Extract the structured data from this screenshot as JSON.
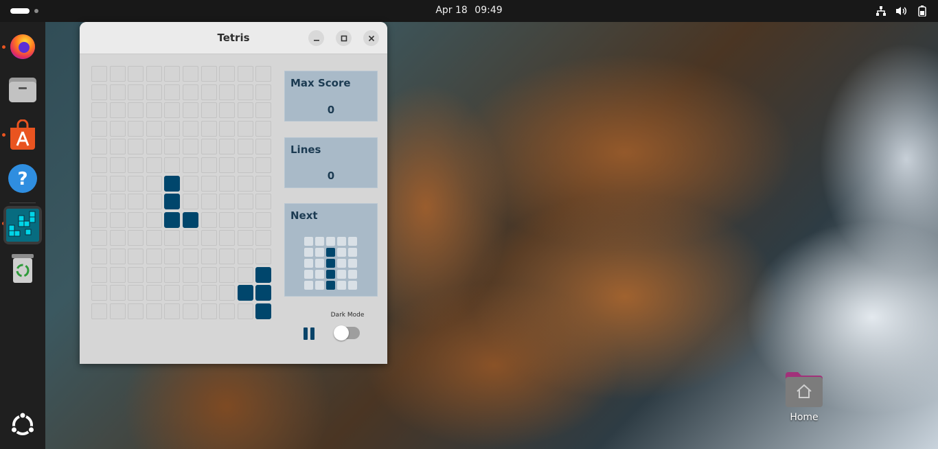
{
  "topbar": {
    "date": "Apr 18",
    "time": "09:49",
    "tray_icons": [
      "network-icon",
      "volume-icon",
      "battery-icon"
    ]
  },
  "dock": {
    "items": [
      {
        "name": "firefox",
        "icon": "firefox-icon",
        "running": true
      },
      {
        "name": "files",
        "icon": "files-icon",
        "running": false
      },
      {
        "name": "app-center",
        "icon": "app-center-icon",
        "running": true
      },
      {
        "name": "help",
        "icon": "help-icon",
        "running": false
      },
      {
        "name": "tetris",
        "icon": "tetris-icon",
        "running": true,
        "active": true
      },
      {
        "name": "trash",
        "icon": "trash-icon",
        "running": false
      }
    ],
    "apps_grid_icon": "ubuntu-logo-icon"
  },
  "desktop": {
    "home_label": "Home"
  },
  "window": {
    "title": "Tetris",
    "controls": [
      "minimize",
      "maximize",
      "close"
    ]
  },
  "game": {
    "board": {
      "columns": 10,
      "rows": 14,
      "filled_cells": [
        [
          6,
          4
        ],
        [
          7,
          4
        ],
        [
          8,
          4
        ],
        [
          8,
          5
        ],
        [
          11,
          9
        ],
        [
          12,
          8
        ],
        [
          12,
          9
        ],
        [
          13,
          9
        ]
      ],
      "filled_color": "#00466c",
      "empty_color": "#d4d4d4"
    },
    "max_score": {
      "label": "Max Score",
      "value": "0"
    },
    "lines": {
      "label": "Lines",
      "value": "0"
    },
    "next": {
      "label": "Next",
      "grid_size": 5,
      "filled_cells": [
        [
          1,
          2
        ],
        [
          2,
          2
        ],
        [
          3,
          2
        ],
        [
          4,
          2
        ]
      ]
    },
    "pause_icon": "pause-icon",
    "dark_mode": {
      "label": "Dark Mode",
      "enabled": false
    }
  },
  "colors": {
    "accent": "#00466c",
    "panel_bg": "#a9bac8",
    "ubuntu_orange": "#e95420"
  }
}
